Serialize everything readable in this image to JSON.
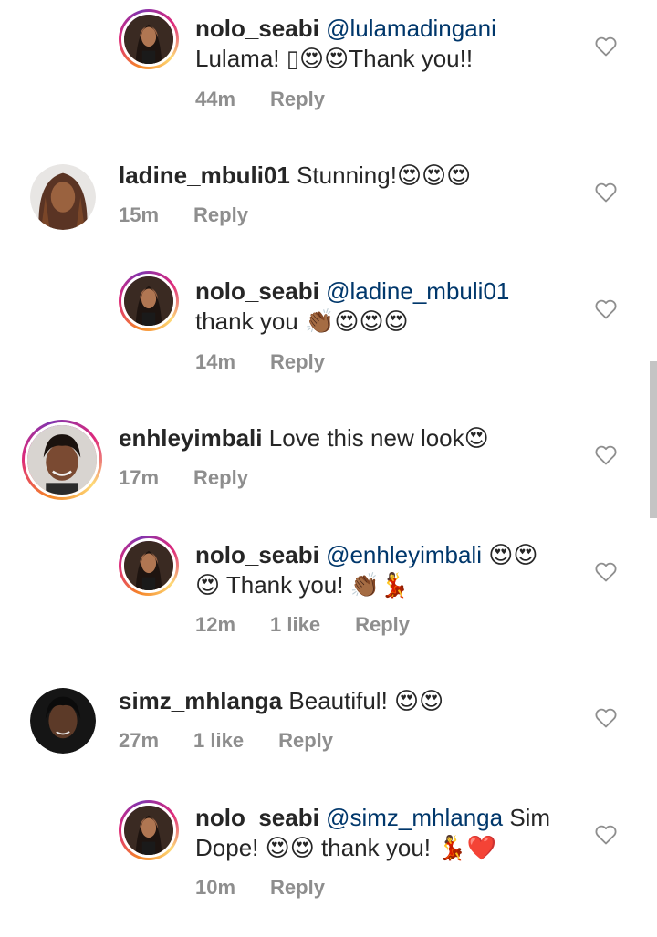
{
  "colors": {
    "text": "#262626",
    "secondary": "#8e8e8e",
    "mention": "#00376b",
    "heart_outline": "#8e8e8e",
    "red_heart": "#e0245e"
  },
  "comments": [
    {
      "author": "nolo_seabi",
      "mention": "@lulamadingani",
      "text_before": "",
      "line2": "Lulama! ▯😍😍Thank you!!",
      "time": "44m",
      "likes": "",
      "reply": "Reply",
      "avatar": "nolo",
      "is_reply": true,
      "icon": "heart-outline-icon"
    },
    {
      "author": "ladine_mbuli01",
      "text": "Stunning!😍😍😍",
      "time": "15m",
      "likes": "",
      "reply": "Reply",
      "avatar": "ladine",
      "is_reply": false,
      "icon": "heart-outline-icon"
    },
    {
      "author": "nolo_seabi",
      "mention": "@ladine_mbuli01",
      "line2": "thank you 👏🏾😍😍😍",
      "time": "14m",
      "likes": "",
      "reply": "Reply",
      "avatar": "nolo",
      "is_reply": true,
      "icon": "heart-outline-icon"
    },
    {
      "author": "enhleyimbali",
      "text": "Love this new look😍",
      "time": "17m",
      "likes": "",
      "reply": "Reply",
      "avatar": "enhley",
      "is_reply": false,
      "icon": "heart-outline-icon"
    },
    {
      "author": "nolo_seabi",
      "mention": "@enhleyimbali",
      "mention_suffix": " 😍😍",
      "line2": "😍 Thank you! 👏🏾💃",
      "time": "12m",
      "likes": "1 like",
      "reply": "Reply",
      "avatar": "nolo",
      "is_reply": true,
      "icon": "heart-outline-icon"
    },
    {
      "author": "simz_mhlanga",
      "text": "Beautiful! 😍😍",
      "time": "27m",
      "likes": "1 like",
      "reply": "Reply",
      "avatar": "simz",
      "is_reply": false,
      "icon": "heart-outline-icon"
    },
    {
      "author": "nolo_seabi",
      "mention": "@simz_mhlanga",
      "mention_suffix": " Sim",
      "line2": "Dope! 😍😍 thank you! 💃❤️",
      "time": "10m",
      "likes": "",
      "reply": "Reply",
      "avatar": "nolo",
      "is_reply": true,
      "icon": "heart-outline-icon"
    }
  ]
}
